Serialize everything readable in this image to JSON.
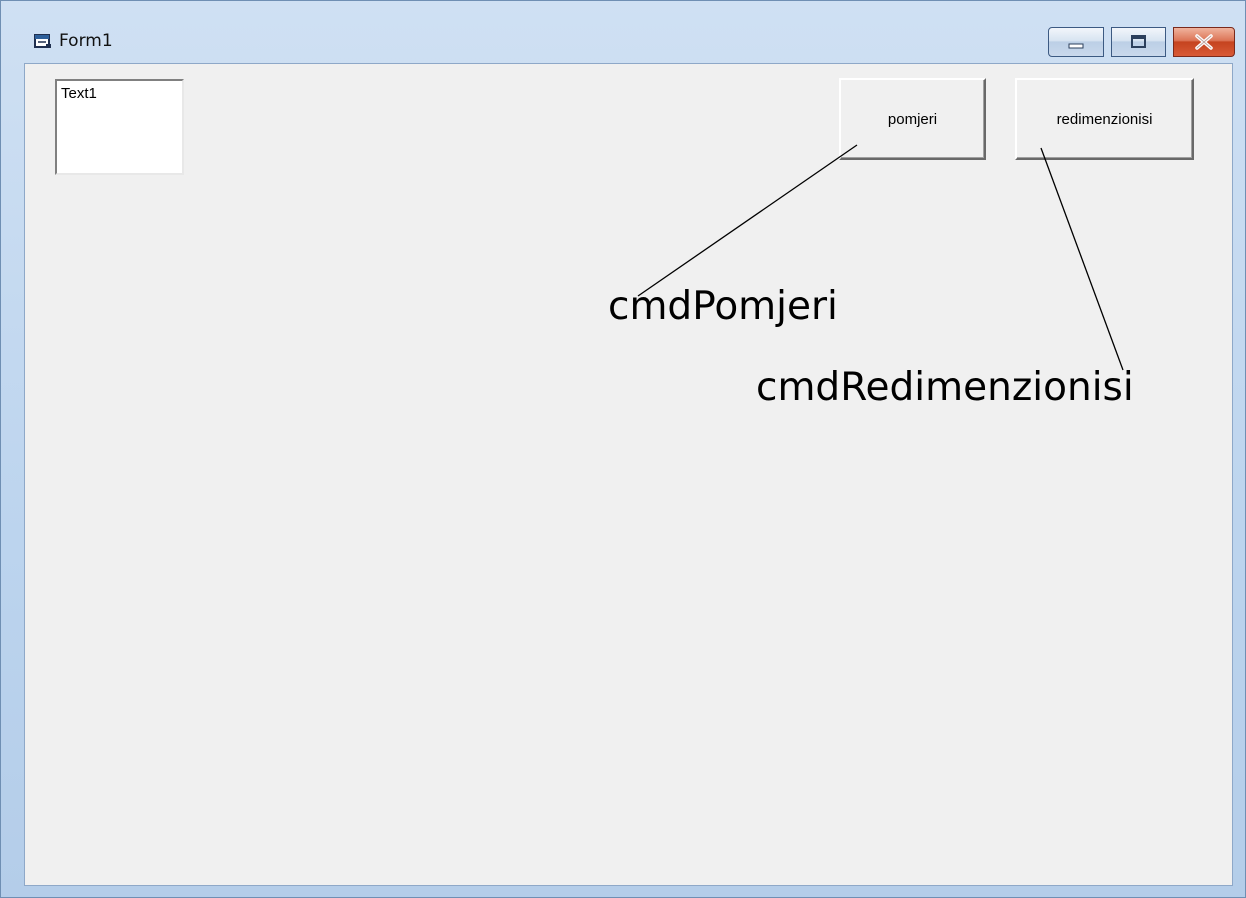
{
  "window": {
    "title": "Form1",
    "icon": "form-icon",
    "controls": {
      "minimize_icon": "minimize-icon",
      "maximize_icon": "maximize-icon",
      "close_icon": "close-icon"
    }
  },
  "form": {
    "textbox": {
      "value": "Text1"
    },
    "buttons": {
      "pomjeri": "pomjeri",
      "redimenzionisi": "redimenzionisi"
    }
  },
  "annotations": {
    "pomjeri_name": "cmdPomjeri",
    "redimenzionisi_name": "cmdRedimenzionisi"
  },
  "colors": {
    "client_bg": "#f0f0f0",
    "titlebar": "#bcd4ee",
    "close_button": "#c5431f"
  }
}
